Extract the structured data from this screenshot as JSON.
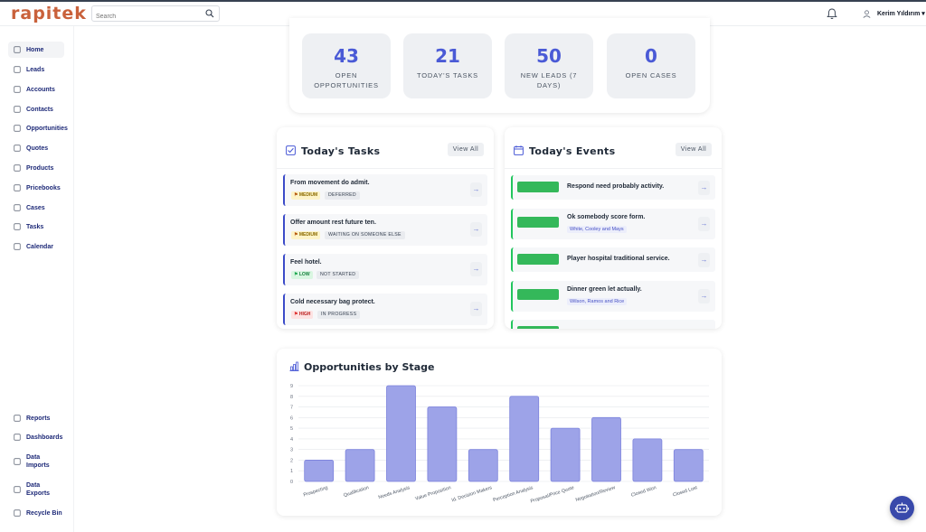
{
  "app": {
    "logo": "rapitek"
  },
  "header": {
    "search_placeholder": "Search",
    "user_name": "Kerim Yıldırım ▾"
  },
  "sidebar": {
    "items": [
      {
        "label": "Home",
        "icon": "home-icon",
        "active": true
      },
      {
        "label": "Leads",
        "icon": "user-icon"
      },
      {
        "label": "Accounts",
        "icon": "building-icon"
      },
      {
        "label": "Contacts",
        "icon": "contacts-icon"
      },
      {
        "label": "Opportunities",
        "icon": "handshake-icon"
      },
      {
        "label": "Quotes",
        "icon": "document-icon"
      },
      {
        "label": "Products",
        "icon": "box-icon"
      },
      {
        "label": "Pricebooks",
        "icon": "book-icon"
      },
      {
        "label": "Cases",
        "icon": "warning-icon"
      },
      {
        "label": "Tasks",
        "icon": "clipboard-icon"
      },
      {
        "label": "Calendar",
        "icon": "calendar-icon"
      }
    ],
    "bottom_items": [
      {
        "label": "Reports",
        "icon": "chart-icon"
      },
      {
        "label": "Dashboards",
        "icon": "grid-icon"
      },
      {
        "label": "Data\nImports",
        "icon": "import-icon"
      },
      {
        "label": "Data\nExports",
        "icon": "export-icon"
      },
      {
        "label": "Recycle Bin",
        "icon": "trash-icon"
      }
    ]
  },
  "stats": [
    {
      "value": "43",
      "label": "Open Opportunities"
    },
    {
      "value": "21",
      "label": "Today's Tasks"
    },
    {
      "value": "50",
      "label": "New Leads (7 Days)"
    },
    {
      "value": "0",
      "label": "Open Cases"
    }
  ],
  "tasks_panel": {
    "title": "Today's Tasks",
    "view_all": "View All",
    "tasks": [
      {
        "title": "From movement do admit.",
        "priority": "MEDIUM",
        "status": "DEFERRED"
      },
      {
        "title": "Offer amount rest future ten.",
        "priority": "MEDIUM",
        "status": "WAITING ON SOMEONE ELSE"
      },
      {
        "title": "Feel hotel.",
        "priority": "LOW",
        "status": "NOT STARTED"
      },
      {
        "title": "Cold necessary bag protect.",
        "priority": "HIGH",
        "status": "IN PROGRESS"
      }
    ]
  },
  "events_panel": {
    "title": "Today's Events",
    "view_all": "View All",
    "events": [
      {
        "title": "Respond need probably activity.",
        "sub": ""
      },
      {
        "title": "Ok somebody score form.",
        "sub": "White, Cooley and Mays"
      },
      {
        "title": "Player hospital traditional service.",
        "sub": ""
      },
      {
        "title": "Dinner green let actually.",
        "sub": "Wilson, Ramos and Rice"
      }
    ]
  },
  "colors": {
    "accent": "#4a5ad6",
    "bar_fill": "#9da3e8",
    "bar_stroke": "#7c83dc",
    "event_green": "#34b85a"
  },
  "chart_data": {
    "type": "bar",
    "title": "Opportunities by Stage",
    "categories": [
      "Prospecting",
      "Qualification",
      "Needs Analysis",
      "Value Proposition",
      "Id. Decision Makers",
      "Perception Analysis",
      "Proposal/Price Quote",
      "Negotiation/Review",
      "Closed Won",
      "Closed Lost"
    ],
    "values": [
      2,
      3,
      9,
      7,
      3,
      8,
      5,
      6,
      4,
      3
    ],
    "ylim": [
      0,
      9
    ],
    "yticks": [
      0,
      1,
      2,
      3,
      4,
      5,
      6,
      7,
      8,
      9
    ],
    "grid": true
  }
}
